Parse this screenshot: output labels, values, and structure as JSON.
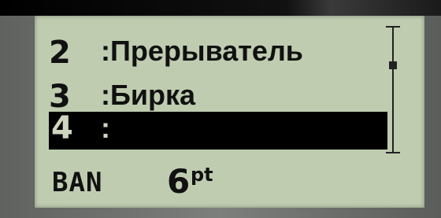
{
  "menu": {
    "items": [
      {
        "number": "2",
        "label": ":Прерыватель",
        "selected": false
      },
      {
        "number": "3",
        "label": ":Бирка",
        "selected": false
      },
      {
        "number": "4",
        "label": ":",
        "selected": true
      }
    ]
  },
  "status": {
    "mode": "BAN",
    "font_size": "6",
    "font_unit": "pt"
  },
  "colors": {
    "lcd_background": "#bfccb0",
    "text": "#111111",
    "highlight": "#000000"
  },
  "icons": [
    "scrollbar-icon"
  ]
}
